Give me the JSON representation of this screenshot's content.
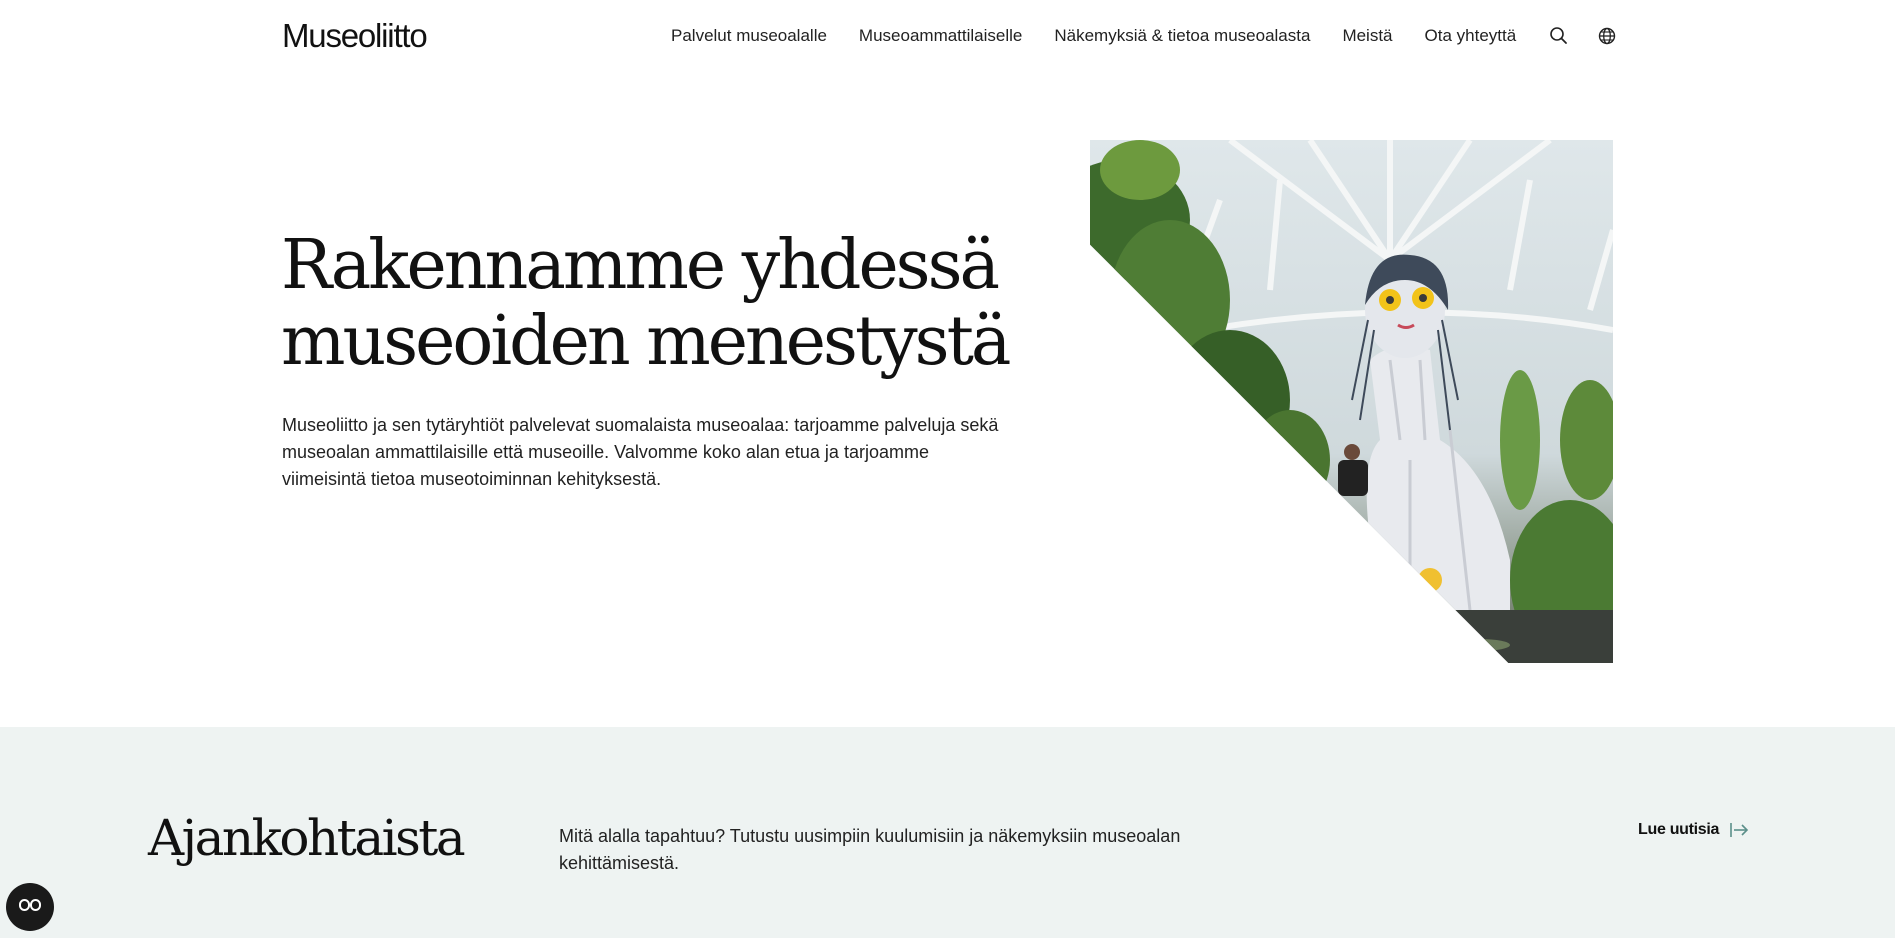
{
  "header": {
    "logo": "Museoliitto",
    "nav": [
      {
        "label": "Palvelut museoalalle"
      },
      {
        "label": "Museoammattilaiselle"
      },
      {
        "label": "Näkemyksiä & tietoa museoalasta"
      },
      {
        "label": "Meistä"
      },
      {
        "label": "Ota yhteyttä"
      }
    ],
    "icons": [
      "search-icon",
      "globe-icon"
    ]
  },
  "hero": {
    "title_line1": "Rakennamme yhdessä",
    "title_line2": "museoiden menestystä",
    "text": "Museoliitto ja sen tytäryhtiöt palvelevat suomalaista museoalaa: tarjoamme palveluja sekä museoalan ammattilaisille että museoille. Valvomme koko alan etua ja tarjoamme viimeisintä tietoa museotoiminnan kehityksestä."
  },
  "news": {
    "title": "Ajankohtaista",
    "text": "Mitä alalla tapahtuu? Tutustu uusimpiin kuulumisiin ja näkemyksiin museoalan kehittämisestä.",
    "link_label": "Lue uutisia",
    "link_icon": "arrow-right-icon"
  },
  "accessibility": {
    "icon": "accessibility-icon"
  },
  "colors": {
    "band_background": "#eef3f2",
    "text": "#1a1a1a",
    "accent_arrow": "#5b8f8a"
  }
}
